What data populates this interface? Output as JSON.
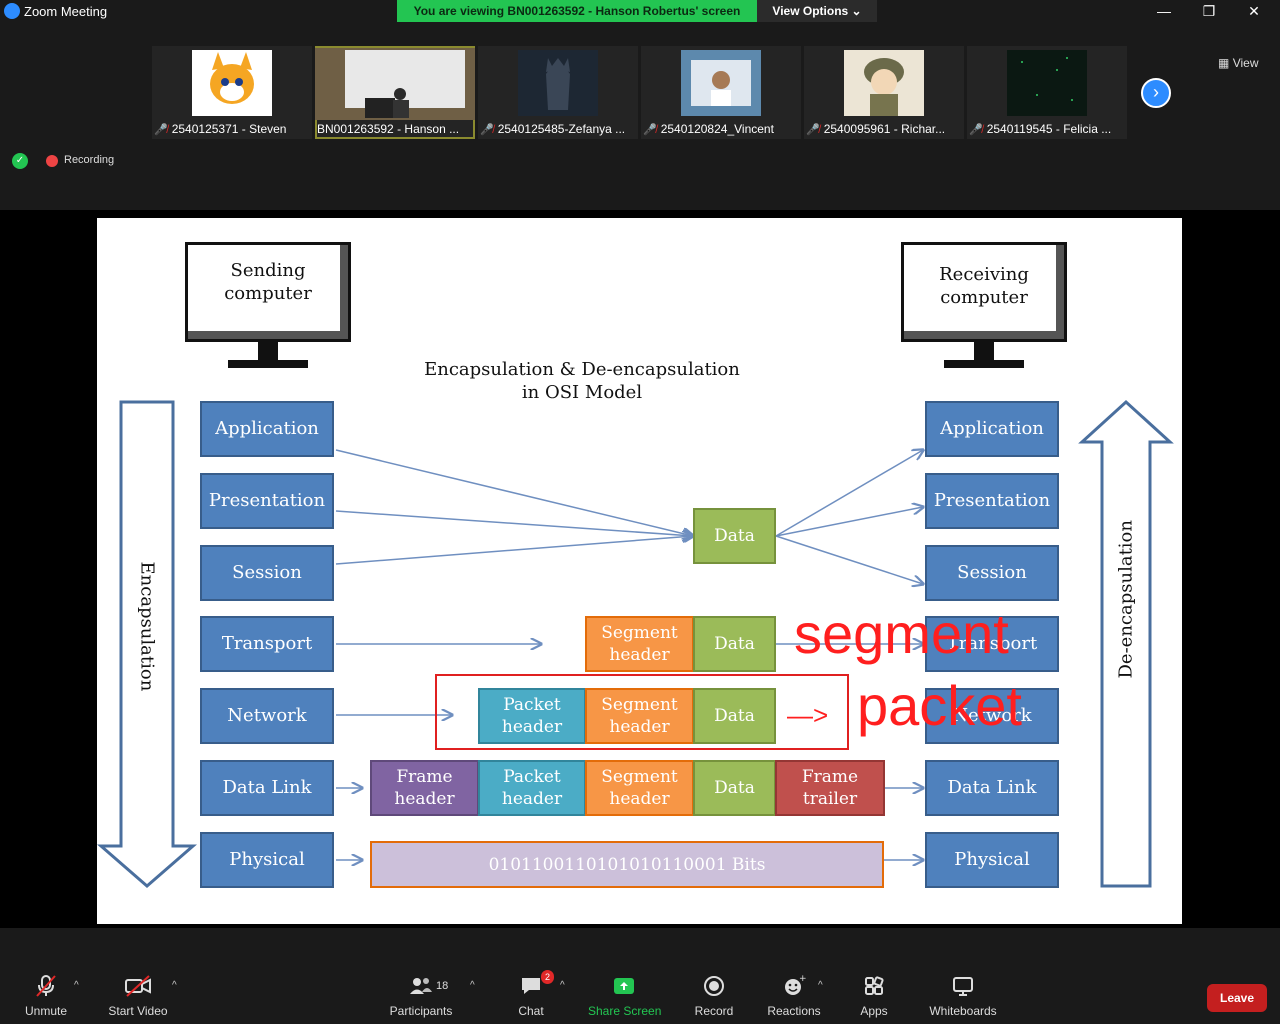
{
  "window": {
    "title": "Zoom Meeting",
    "viewing_banner": "You are viewing BN001263592 - Hanson Robertus' screen",
    "view_options": "View Options ⌄",
    "minimize": "—",
    "maximize": "❐",
    "close": "✕"
  },
  "gallery": {
    "view_label": "View",
    "participants": [
      {
        "name": "2540125371 - Steven",
        "muted": true
      },
      {
        "name": "BN001263592 - Hanson ...",
        "muted": false
      },
      {
        "name": "2540125485-Zefanya ...",
        "muted": true
      },
      {
        "name": "2540120824_Vincent",
        "muted": true
      },
      {
        "name": "2540095961 - Richar...",
        "muted": true
      },
      {
        "name": "2540119545 - Felicia ...",
        "muted": true
      }
    ],
    "next_icon": "›"
  },
  "status": {
    "recording_label": "Recording"
  },
  "slide": {
    "sending": "Sending computer",
    "receiving": "Receiving computer",
    "title_line1": "Encapsulation & De-encapsulation",
    "title_line2": "in OSI Model",
    "left_layers": [
      "Application",
      "Presentation",
      "Session",
      "Transport",
      "Network",
      "Data Link",
      "Physical"
    ],
    "right_layers": [
      "Application",
      "Presentation",
      "Session",
      "Transport",
      "Network",
      "Data Link",
      "Physical"
    ],
    "encapsulation_label": "Encapsulation",
    "deencapsulation_label": "De-encapsulation",
    "data": "Data",
    "segment_header": "Segment header",
    "packet_header": "Packet header",
    "frame_header": "Frame header",
    "frame_trailer": "Frame trailer",
    "bits": "0101100110101010110001 Bits",
    "annotation_segment": "segment",
    "annotation_packet": "packet",
    "annotation_arrow": "—>"
  },
  "toolbar": {
    "unmute": "Unmute",
    "start_video": "Start Video",
    "participants": "Participants",
    "participants_count": "18",
    "chat": "Chat",
    "chat_badge": "2",
    "share_screen": "Share Screen",
    "record": "Record",
    "reactions": "Reactions",
    "apps": "Apps",
    "whiteboards": "Whiteboards",
    "leave": "Leave"
  },
  "colors": {
    "zoom_blue": "#2d8cff",
    "banner_green": "#23c552",
    "layer_blue": "#4f81bd",
    "data_green": "#9bbb59",
    "segment_orange": "#f79646",
    "packet_cyan": "#4bacc6",
    "frame_purple": "#8064a2",
    "trailer_red": "#c0504d",
    "leave_red": "#c41f1f",
    "annotation_red": "#ff1f1f"
  }
}
